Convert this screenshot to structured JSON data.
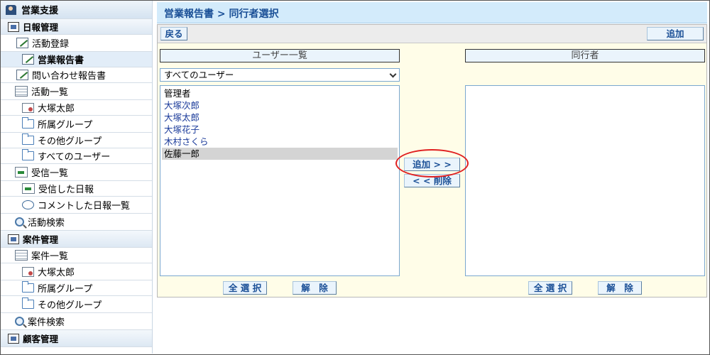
{
  "sidebar": {
    "top": {
      "label": "営業支援",
      "icon": "user-icon"
    },
    "items": [
      {
        "label": "日報管理",
        "icon": "briefcase-icon",
        "kind": "section"
      },
      {
        "label": "活動登録",
        "icon": "edit-icon",
        "kind": "item"
      },
      {
        "label": "営業報告書",
        "icon": "edit-icon",
        "kind": "selected"
      },
      {
        "label": "問い合わせ報告書",
        "icon": "edit-icon",
        "kind": "item"
      },
      {
        "label": "活動一覧",
        "icon": "list-icon",
        "kind": "item"
      },
      {
        "label": "大塚太郎",
        "icon": "person-icon",
        "kind": "sub"
      },
      {
        "label": "所属グループ",
        "icon": "folder-icon",
        "kind": "sub"
      },
      {
        "label": "その他グループ",
        "icon": "folder-icon",
        "kind": "sub"
      },
      {
        "label": "すべてのユーザー",
        "icon": "folder-icon",
        "kind": "sub"
      },
      {
        "label": "受信一覧",
        "icon": "inbox-icon",
        "kind": "item"
      },
      {
        "label": "受信した日報",
        "icon": "inbox-icon",
        "kind": "sub"
      },
      {
        "label": "コメントした日報一覧",
        "icon": "comment-icon",
        "kind": "sub"
      },
      {
        "label": "活動検索",
        "icon": "search-icon",
        "kind": "item"
      },
      {
        "label": "案件管理",
        "icon": "briefcase-icon",
        "kind": "section"
      },
      {
        "label": "案件一覧",
        "icon": "list-icon",
        "kind": "item"
      },
      {
        "label": "大塚太郎",
        "icon": "person-icon",
        "kind": "sub"
      },
      {
        "label": "所属グループ",
        "icon": "folder-icon",
        "kind": "sub"
      },
      {
        "label": "その他グループ",
        "icon": "folder-icon",
        "kind": "sub"
      },
      {
        "label": "案件検索",
        "icon": "search-icon",
        "kind": "item"
      },
      {
        "label": "顧客管理",
        "icon": "briefcase-icon",
        "kind": "section"
      }
    ]
  },
  "main": {
    "title": "営業報告書 > 同行者選択",
    "back_label": "戻る",
    "add_label": "追加",
    "users_header": "ユーザー一覧",
    "companions_header": "同行者",
    "filter_value": "すべてのユーザー",
    "users": [
      "管理者",
      "大塚次郎",
      "大塚太郎",
      "大塚花子",
      "木村さくら",
      "佐藤一郎"
    ],
    "selected_user": "佐藤一郎",
    "companions": [],
    "move_add_label": "追加 > >",
    "move_remove_label": "< < 削除",
    "select_all_label": "全 選 択",
    "clear_label": "解　除"
  },
  "colors": {
    "title_bar": "#d3ebfb",
    "panel_bg": "#fffde8",
    "highlight_circle": "#e02020"
  }
}
